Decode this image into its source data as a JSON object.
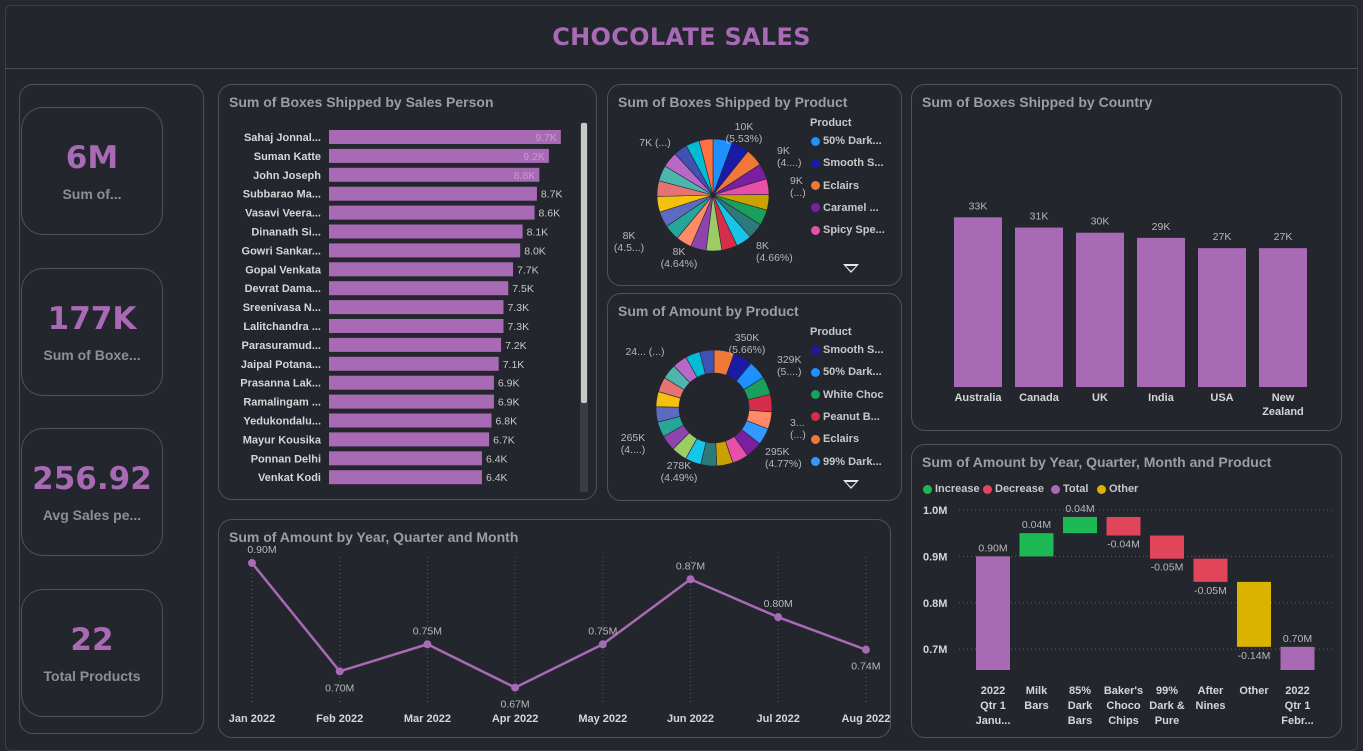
{
  "header": {
    "title": "CHOCOLATE SALES"
  },
  "kpis": [
    {
      "value": "6M",
      "label": "Sum of..."
    },
    {
      "value": "177K",
      "label": "Sum of Boxe..."
    },
    {
      "value": "256.92",
      "label": "Avg Sales pe..."
    },
    {
      "value": "22",
      "label": "Total Products"
    }
  ],
  "colors": {
    "accent": "#a86ab4",
    "bar": "#a86ab4",
    "increase": "#1db954",
    "decrease": "#e0455a",
    "total": "#a86ab4",
    "other": "#d9b300"
  },
  "chart_data": [
    {
      "type": "bar",
      "orientation": "horizontal",
      "title": "Sum of Boxes Shipped by Sales Person",
      "categories": [
        "Sahaj Jonnal...",
        "Suman Katte",
        "John Joseph",
        "Subbarao Ma...",
        "Vasavi Veera...",
        "Dinanath Si...",
        "Gowri Sankar...",
        "Gopal Venkata",
        "Devrat Dama...",
        "Sreenivasa N...",
        "Lalitchandra ...",
        "Parasuramud...",
        "Jaipal Potana...",
        "Prasanna Lak...",
        "Ramalingam ...",
        "Yedukondalu...",
        "Mayur Kousika",
        "Ponnan Delhi",
        "Venkat Kodi"
      ],
      "values": [
        9.7,
        9.2,
        8.8,
        8.7,
        8.6,
        8.1,
        8.0,
        7.7,
        7.5,
        7.3,
        7.3,
        7.2,
        7.1,
        6.9,
        6.9,
        6.8,
        6.7,
        6.4,
        6.4
      ],
      "labels": [
        "9.7K",
        "9.2K",
        "8.8K",
        "8.7K",
        "8.6K",
        "8.1K",
        "8.0K",
        "7.7K",
        "7.5K",
        "7.3K",
        "7.3K",
        "7.2K",
        "7.1K",
        "6.9K",
        "6.9K",
        "6.8K",
        "6.7K",
        "6.4K",
        "6.4K"
      ],
      "xlim": [
        0,
        10
      ]
    },
    {
      "type": "pie",
      "title": "Sum of Boxes Shipped by Product",
      "legend_title": "Product",
      "legend": [
        "50% Dark...",
        "Smooth S...",
        "Eclairs",
        "Caramel ...",
        "Spicy Spe..."
      ],
      "legend_colors": [
        "#1e90ff",
        "#1a1aa6",
        "#f07838",
        "#7b1fa2",
        "#e84fa8"
      ],
      "slice_colors": [
        "#1e90ff",
        "#1a1aa6",
        "#f07838",
        "#7b1fa2",
        "#e84fa8",
        "#c9a100",
        "#1aa05b",
        "#2c7a7b",
        "#17c5e8",
        "#d62d4a",
        "#9ccc65",
        "#8e44ad",
        "#ff8a65",
        "#26a69a",
        "#5c6bc0",
        "#f4c20d",
        "#e57373",
        "#4db6ac",
        "#ba68c8",
        "#3f51b5",
        "#00bcd4",
        "#ff7043"
      ],
      "values": [
        10,
        9,
        9,
        8,
        8,
        8,
        8,
        8,
        8,
        8,
        8,
        8,
        8,
        8,
        8,
        8,
        8,
        8,
        8,
        7,
        7,
        7
      ],
      "data_labels": [
        {
          "text": "10K",
          "sub": "(5.53%)"
        },
        {
          "text": "9K",
          "sub": "(4....)"
        },
        {
          "text": "9K",
          "sub": "(...)"
        },
        {
          "text": "8K",
          "sub": "(4.66%)"
        },
        {
          "text": "8K",
          "sub": "(4.64%)"
        },
        {
          "text": "8K",
          "sub": "(4.5...)"
        },
        {
          "text": "7K (...)",
          "sub": ""
        }
      ]
    },
    {
      "type": "pie",
      "subtype": "donut",
      "title": "Sum of Amount by Product",
      "legend_title": "Product",
      "legend": [
        "Smooth S...",
        "50% Dark...",
        "White Choc",
        "Peanut B...",
        "Eclairs",
        "99% Dark..."
      ],
      "legend_colors": [
        "#1a1aa6",
        "#1e90ff",
        "#1aa05b",
        "#d62d4a",
        "#f07838",
        "#3399ff"
      ],
      "slice_colors": [
        "#f07838",
        "#1a1aa6",
        "#1e90ff",
        "#1aa05b",
        "#d62d4a",
        "#ff8a65",
        "#3399ff",
        "#7b1fa2",
        "#e84fa8",
        "#c9a100",
        "#2c7a7b",
        "#17c5e8",
        "#9ccc65",
        "#8e44ad",
        "#26a69a",
        "#5c6bc0",
        "#f4c20d",
        "#e57373",
        "#4db6ac",
        "#ba68c8",
        "#00bcd4",
        "#3f51b5"
      ],
      "values": [
        350,
        329,
        320,
        310,
        300,
        295,
        290,
        285,
        280,
        278,
        275,
        272,
        270,
        268,
        265,
        262,
        260,
        258,
        255,
        252,
        250,
        245
      ],
      "data_labels": [
        {
          "text": "350K",
          "sub": "(5.66%)"
        },
        {
          "text": "329K",
          "sub": "(5....)"
        },
        {
          "text": "3...",
          "sub": "(...)"
        },
        {
          "text": "295K",
          "sub": "(4.77%)"
        },
        {
          "text": "278K",
          "sub": "(4.49%)"
        },
        {
          "text": "265K",
          "sub": "(4....)"
        },
        {
          "text": "24... (...)",
          "sub": ""
        }
      ]
    },
    {
      "type": "bar",
      "title": "Sum of Boxes Shipped by Country",
      "categories": [
        "Australia",
        "Canada",
        "UK",
        "India",
        "USA",
        "New Zealand"
      ],
      "values": [
        33,
        31,
        30,
        29,
        27,
        27
      ],
      "labels": [
        "33K",
        "31K",
        "30K",
        "29K",
        "27K",
        "27K"
      ],
      "ylim": [
        0,
        35
      ]
    },
    {
      "type": "line",
      "title": "Sum of Amount by Year, Quarter and Month",
      "x": [
        "Jan 2022",
        "Feb 2022",
        "Mar 2022",
        "Apr 2022",
        "May 2022",
        "Jun 2022",
        "Jul 2022",
        "Aug 2022"
      ],
      "values": [
        0.9,
        0.7,
        0.75,
        0.67,
        0.75,
        0.87,
        0.8,
        0.74
      ],
      "labels": [
        "0.90M",
        "0.70M",
        "0.75M",
        "0.67M",
        "0.75M",
        "0.87M",
        "0.80M",
        "0.74M"
      ],
      "ylim": [
        0.66,
        0.9
      ]
    },
    {
      "type": "bar",
      "subtype": "waterfall",
      "title": "Sum of Amount by Year, Quarter, Month and Product",
      "legend": [
        {
          "name": "Increase",
          "color": "#1db954"
        },
        {
          "name": "Decrease",
          "color": "#e0455a"
        },
        {
          "name": "Total",
          "color": "#a86ab4"
        },
        {
          "name": "Other",
          "color": "#d9b300"
        }
      ],
      "categories": [
        [
          "2022",
          "Qtr 1",
          "Janu..."
        ],
        [
          "Milk",
          "Bars"
        ],
        [
          "85%",
          "Dark",
          "Bars"
        ],
        [
          "Baker's",
          "Choco",
          "Chips"
        ],
        [
          "99%",
          "Dark &",
          "Pure"
        ],
        [
          "After",
          "Nines"
        ],
        [
          "Other"
        ],
        [
          "2022",
          "Qtr 1",
          "Febr..."
        ]
      ],
      "steps": [
        {
          "kind": "total",
          "start": 0,
          "end": 0.9,
          "label": "0.90M"
        },
        {
          "kind": "increase",
          "start": 0.9,
          "end": 0.95,
          "label": "0.04M"
        },
        {
          "kind": "increase",
          "start": 0.95,
          "end": 0.985,
          "label": "0.04M"
        },
        {
          "kind": "decrease",
          "start": 0.985,
          "end": 0.945,
          "label": "-0.04M"
        },
        {
          "kind": "decrease",
          "start": 0.945,
          "end": 0.895,
          "label": "-0.05M"
        },
        {
          "kind": "decrease",
          "start": 0.895,
          "end": 0.845,
          "label": "-0.05M"
        },
        {
          "kind": "other",
          "start": 0.845,
          "end": 0.705,
          "label": "-0.14M"
        },
        {
          "kind": "total",
          "start": 0,
          "end": 0.705,
          "label": "0.70M"
        }
      ],
      "yticks": [
        "1.0M",
        "0.9M",
        "0.8M",
        "0.7M"
      ],
      "ytick_values": [
        1.0,
        0.9,
        0.8,
        0.7
      ],
      "ylim": [
        0.655,
        1.0
      ]
    }
  ]
}
